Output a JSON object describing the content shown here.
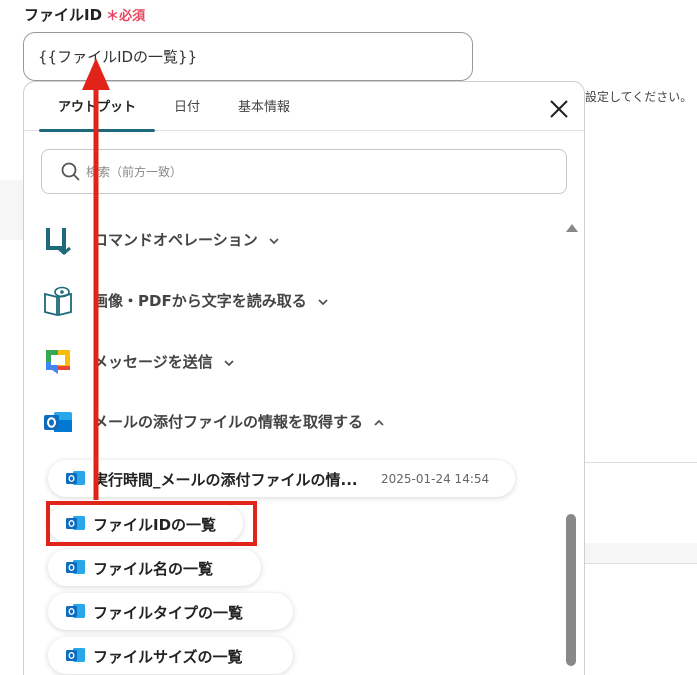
{
  "field": {
    "label": "ファイルID",
    "required_mark": "＊",
    "required_text": "必須",
    "value": "{{ファイルIDの一覧}}"
  },
  "background": {
    "hint": "設定してください。"
  },
  "panel": {
    "tabs": [
      {
        "label": "アウトプット",
        "active": true
      },
      {
        "label": "日付",
        "active": false
      },
      {
        "label": "基本情報",
        "active": false
      }
    ],
    "search_placeholder": "検索（前方一致）",
    "sections": [
      {
        "label": "コマンドオペレーション",
        "icon": "command-operation-icon",
        "expanded": false
      },
      {
        "label": "画像・PDFから文字を読み取る",
        "icon": "ocr-book-icon",
        "expanded": false
      },
      {
        "label": "メッセージを送信",
        "icon": "google-chat-icon",
        "expanded": false
      },
      {
        "label": "メールの添付ファイルの情報を取得する",
        "icon": "outlook-icon",
        "expanded": true
      }
    ],
    "items": [
      {
        "label": "実行時間_メールの添付ファイルの情...",
        "date": "2025-01-24 14:54"
      },
      {
        "label": "ファイルIDの一覧",
        "date": ""
      },
      {
        "label": "ファイル名の一覧",
        "date": ""
      },
      {
        "label": "ファイルタイプの一覧",
        "date": ""
      },
      {
        "label": "ファイルサイズの一覧",
        "date": ""
      }
    ]
  },
  "colors": {
    "accent": "#1e6a7a",
    "required": "#e8475f",
    "annotation": "#e2231a",
    "outlook": "#0f6cbd"
  }
}
